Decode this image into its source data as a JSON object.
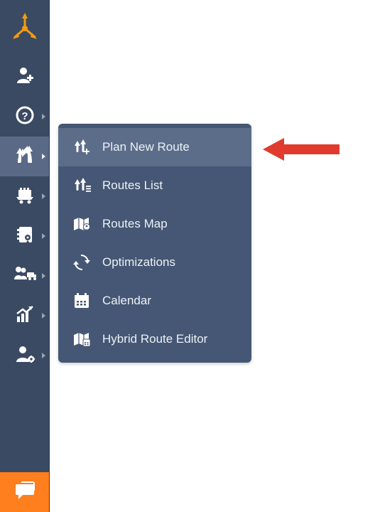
{
  "colors": {
    "sidebar_bg": "#3b4a63",
    "flyout_bg": "#455774",
    "highlight_bg": "#5c6d8a",
    "accent_orange": "#ff7f1f",
    "logo_orange": "#f39c12",
    "annotation_red": "#e03b2d"
  },
  "sidebar": {
    "items": [
      {
        "name": "logo",
        "icon": "logo-arrows",
        "has_caret": false,
        "interact": false
      },
      {
        "name": "add-user",
        "icon": "user-plus",
        "has_caret": false,
        "interact": true
      },
      {
        "name": "help",
        "icon": "help-circle",
        "has_caret": true,
        "interact": true
      },
      {
        "name": "routes",
        "icon": "route-arrows",
        "has_caret": true,
        "interact": true,
        "active": true
      },
      {
        "name": "orders",
        "icon": "cart",
        "has_caret": true,
        "interact": true
      },
      {
        "name": "addressbook",
        "icon": "book-pin",
        "has_caret": true,
        "interact": true
      },
      {
        "name": "team",
        "icon": "users-truck",
        "has_caret": true,
        "interact": true
      },
      {
        "name": "analytics",
        "icon": "chart-up",
        "has_caret": true,
        "interact": true
      },
      {
        "name": "admin",
        "icon": "user-gear",
        "has_caret": true,
        "interact": true
      }
    ]
  },
  "flyout": {
    "items": [
      {
        "name": "plan-new-route",
        "icon": "route-plus",
        "label": "Plan New Route",
        "highlight": true
      },
      {
        "name": "routes-list",
        "icon": "route-list",
        "label": "Routes List"
      },
      {
        "name": "routes-map",
        "icon": "map-fold",
        "label": "Routes Map"
      },
      {
        "name": "optimizations",
        "icon": "recycle",
        "label": "Optimizations"
      },
      {
        "name": "calendar",
        "icon": "calendar",
        "label": "Calendar"
      },
      {
        "name": "hybrid-route-editor",
        "icon": "map-clock",
        "label": "Hybrid Route Editor"
      }
    ]
  },
  "footer": {
    "chat_icon": "chat-bubble"
  },
  "annotation": {
    "type": "arrow-left",
    "color": "#e03b2d",
    "target": "plan-new-route"
  }
}
